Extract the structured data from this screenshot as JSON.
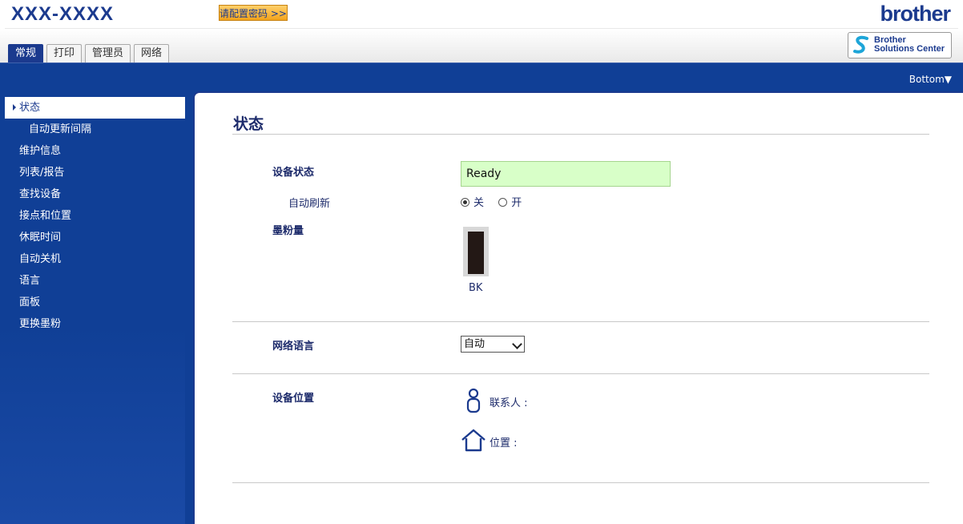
{
  "header": {
    "model": "XXX-XXXX",
    "password_button": "请配置密码 >>",
    "logo": "brother",
    "solutions_center": [
      "Brother",
      "Solutions Center"
    ]
  },
  "tabs": [
    {
      "label": "常规",
      "active": true
    },
    {
      "label": "打印",
      "active": false
    },
    {
      "label": "管理员",
      "active": false
    },
    {
      "label": "网络",
      "active": false
    }
  ],
  "bottom_link": "Bottom▼",
  "sidebar": {
    "items": [
      {
        "label": "状态",
        "active": true,
        "sub": false
      },
      {
        "label": "自动更新间隔",
        "active": false,
        "sub": true
      },
      {
        "label": "维护信息",
        "active": false,
        "sub": false
      },
      {
        "label": "列表/报告",
        "active": false,
        "sub": false
      },
      {
        "label": "查找设备",
        "active": false,
        "sub": false
      },
      {
        "label": "接点和位置",
        "active": false,
        "sub": false
      },
      {
        "label": "休眠时间",
        "active": false,
        "sub": false
      },
      {
        "label": "自动关机",
        "active": false,
        "sub": false
      },
      {
        "label": "语言",
        "active": false,
        "sub": false
      },
      {
        "label": "面板",
        "active": false,
        "sub": false
      },
      {
        "label": "更换墨粉",
        "active": false,
        "sub": false
      }
    ]
  },
  "main": {
    "title": "状态",
    "device_status_label": "设备状态",
    "device_status_value": "Ready",
    "auto_refresh_label": "自动刷新",
    "auto_refresh_off": "关",
    "auto_refresh_on": "开",
    "auto_refresh_selected": "off",
    "toner_label": "墨粉量",
    "toner": [
      {
        "name": "BK",
        "level": 0.95,
        "color": "#231815"
      }
    ],
    "web_language_label": "网络语言",
    "web_language_value": "自动",
    "device_location_label": "设备位置",
    "contact_label": "联系人 :",
    "location_label": "位置 :"
  },
  "colors": {
    "brand_blue": "#103f96",
    "status_ok": "#d8ffc8",
    "accent_orange": "#f2a31c"
  }
}
